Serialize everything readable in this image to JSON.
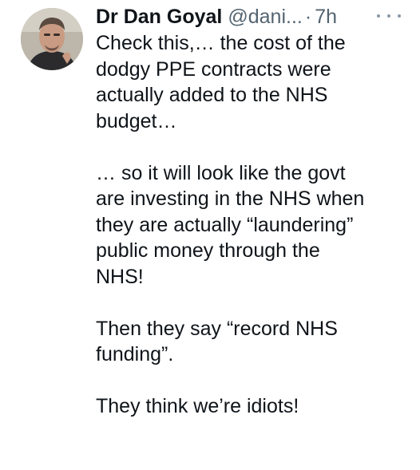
{
  "tweet": {
    "display_name": "Dr Dan Goyal",
    "handle": "@dani...",
    "separator": "·",
    "time": "7h",
    "icons": {
      "avatar": "profile-photo",
      "more": "more-horizontal-icon"
    },
    "paragraphs": [
      "Check this,… the cost of the\ndodgy PPE contracts were\nactually added to the NHS\nbudget…",
      "… so it will look like the govt\nare investing in the NHS when\nthey are actually “laundering”\npublic money through the\nNHS!",
      "Then they say “record NHS\nfunding”.",
      "They think we’re idiots!"
    ]
  },
  "colors": {
    "text": "#0f1419",
    "secondary": "#536471",
    "background": "#ffffff"
  }
}
